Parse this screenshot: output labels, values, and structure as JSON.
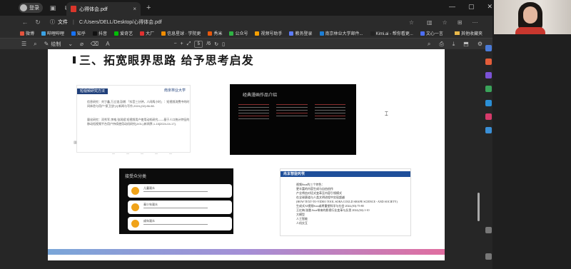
{
  "browser": {
    "profile_label": "登录",
    "tab_title": "心得体会.pdf",
    "tab_close": "×",
    "new_tab": "+",
    "address_scheme_label": "文件",
    "address_path": "C:/Users/DELL/Desktop/心得体会.pdf",
    "window_controls": [
      "—",
      "▢",
      "✕"
    ]
  },
  "bookmarks": {
    "items": [
      {
        "label": "微博",
        "color": "#e5533d"
      },
      {
        "label": "哔哩哔哩",
        "color": "#3aa1e3"
      },
      {
        "label": "知乎",
        "color": "#1772f6"
      },
      {
        "label": "抖音",
        "color": "#111111"
      },
      {
        "label": "爱奇艺",
        "color": "#00be06"
      },
      {
        "label": "大厂",
        "color": "#e03131"
      },
      {
        "label": "信息星球 · 学院更",
        "color": "#f08c00"
      },
      {
        "label": "秀米",
        "color": "#e8590c"
      },
      {
        "label": "公众号",
        "color": "#2fb344"
      },
      {
        "label": "视频号助手",
        "color": "#f59f00"
      },
      {
        "label": "教务登录",
        "color": "#5c7cfa"
      },
      {
        "label": "南京林业大学邮件...",
        "color": "#1c7ed6"
      },
      {
        "label": "Kimi.ai - 帮你看更...",
        "color": "#222222"
      },
      {
        "label": "文心一言",
        "color": "#4c6ef5"
      }
    ],
    "other_label": "其他收藏夹"
  },
  "pdf_toolbar": {
    "draw_label": "绘制",
    "current_page": "5",
    "total_pages": "/6"
  },
  "document": {
    "heading": "三、拓宽眼界思路 给予思考启发",
    "slide1": {
      "tag": "短视频研究方法",
      "seal": "南京林业大学",
      "para1": "信息研究：刘丁鑫,万立谊,彭朗.「抖音三分钟，人间两小时」：短视频消费中的时间体验与用户“保卫战”[J].新闻与写作,2024,(02):86-98.",
      "para2": "量化研究：邓秀军,李唯,张润斌.短视频用户使用动机研究——基于人口统计特征的移动短视频平台用户持续使用动机研究[J/OL].新闻界,1-15[2024-04-17]."
    },
    "slide2": {
      "title": "经典漫画作品介绍"
    },
    "slide3": {
      "title": "接受众分类",
      "cards": [
        "儿童观众",
        "青少年观众",
        "成年观众"
      ]
    },
    "slide4": {
      "header": "人工智能时代",
      "seal": "南京林业大学",
      "lines": [
        "视频Sora的三个特色：",
        "更丰富的内容生成与自由创作",
        "产业将由对话式变革至内容引领模式",
        "在全球赛道与人类文明进程中实现超越",
        "(HOW TEXT-TO-VIDEO TOOL SORA COULD SHAPE SCIENCE - AND SOCIETY)",
        "生成式AI视频Sora或将重塑科学与社会 2024,(03):75-80",
        "王红梅,张雷.Sora带来的影视行业变革与反思 2024,(04):1-10",
        "大模型",
        "人工智能",
        "人机交互"
      ]
    }
  }
}
